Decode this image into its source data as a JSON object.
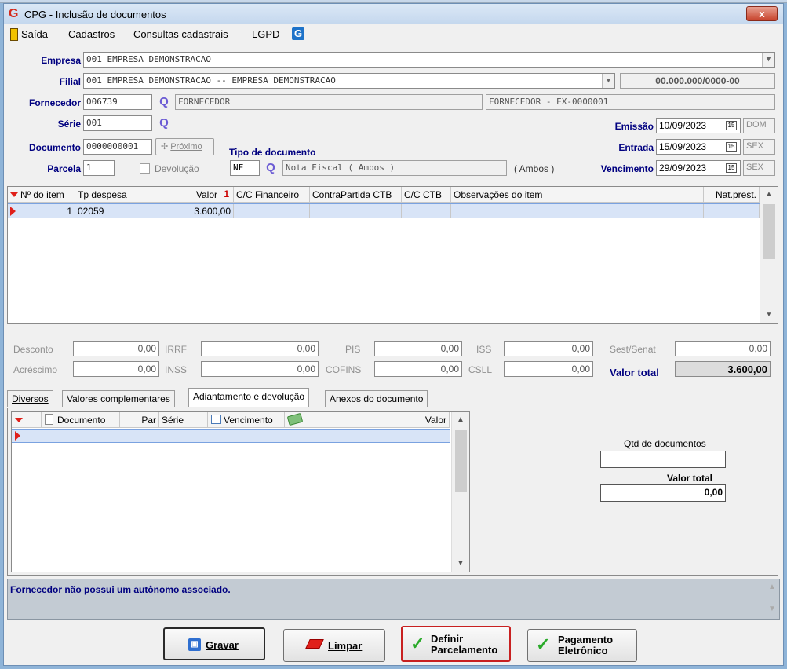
{
  "window": {
    "title": "CPG - Inclusão de documentos",
    "close": "x"
  },
  "menu": {
    "items": [
      "Saída",
      "Cadastros",
      "Consultas cadastrais",
      "LGPD"
    ]
  },
  "form": {
    "empresa_label": "Empresa",
    "empresa_value": "001 EMPRESA DEMONSTRACAO",
    "filial_label": "Filial",
    "filial_value": "001 EMPRESA DEMONSTRACAO -- EMPRESA DEMONSTRACAO",
    "cnpj": "00.000.000/0000-00",
    "fornecedor_label": "Fornecedor",
    "fornecedor_code": "006739",
    "fornecedor_name": "FORNECEDOR",
    "fornecedor_desc": "FORNECEDOR - EX-0000001",
    "serie_label": "Série",
    "serie_value": "001",
    "documento_label": "Documento",
    "documento_value": "0000000001",
    "proximo": "Próximo",
    "tipo_doc_label": "Tipo de documento",
    "tipo_doc_code": "NF",
    "tipo_doc_name": "Nota Fiscal ( Ambos )",
    "tipo_doc_scope": "( Ambos )",
    "parcela_label": "Parcela",
    "parcela_value": "1",
    "devolucao_label": "Devolução",
    "emissao_label": "Emissão",
    "emissao_value": "10/09/2023",
    "emissao_day": "DOM",
    "entrada_label": "Entrada",
    "entrada_value": "15/09/2023",
    "entrada_day": "SEX",
    "vencimento_label": "Vencimento",
    "vencimento_value": "29/09/2023",
    "vencimento_day": "SEX",
    "cal_glyph": "15"
  },
  "items_grid": {
    "columns": [
      "Nº do item",
      "Tp despesa",
      "Valor",
      "C/C Financeiro",
      "ContraPartida CTB",
      "C/C CTB",
      "Observações do item",
      "Nat.prest."
    ],
    "sort_glyph": "1",
    "rows": [
      {
        "item": "1",
        "tp": "02059",
        "valor": "3.600,00"
      }
    ]
  },
  "totals": {
    "desconto": {
      "label": "Desconto",
      "value": "0,00"
    },
    "acrescimo": {
      "label": "Acréscimo",
      "value": "0,00"
    },
    "irrf": {
      "label": "IRRF",
      "value": "0,00"
    },
    "inss": {
      "label": "INSS",
      "value": "0,00"
    },
    "pis": {
      "label": "PIS",
      "value": "0,00"
    },
    "cofins": {
      "label": "COFINS",
      "value": "0,00"
    },
    "iss": {
      "label": "ISS",
      "value": "0,00"
    },
    "csll": {
      "label": "CSLL",
      "value": "0,00"
    },
    "sest": {
      "label": "Sest/Senat",
      "value": "0,00"
    },
    "valor_total_label": "Valor total",
    "valor_total": "3.600,00"
  },
  "tabs": [
    "Diversos",
    "Valores complementares",
    "Adiantamento e devolução",
    "Anexos do documento"
  ],
  "adiant_grid": {
    "columns": [
      "Documento",
      "Par",
      "Série",
      "Vencimento",
      "Valor"
    ]
  },
  "summary": {
    "qtd_label": "Qtd de documentos",
    "qtd_value": "",
    "valor_total_label": "Valor total",
    "valor_total": "0,00"
  },
  "message": "Fornecedor não possui um autônomo associado.",
  "buttons": {
    "gravar": "Gravar",
    "limpar": "Limpar",
    "definir_1": "Definir",
    "definir_2": "Parcelamento",
    "pagamento_1": "Pagamento",
    "pagamento_2": "Eletrônico"
  },
  "colors": {
    "accent_red": "#e0201a",
    "label_blue": "#000080",
    "selection": "#d8e4f7"
  }
}
